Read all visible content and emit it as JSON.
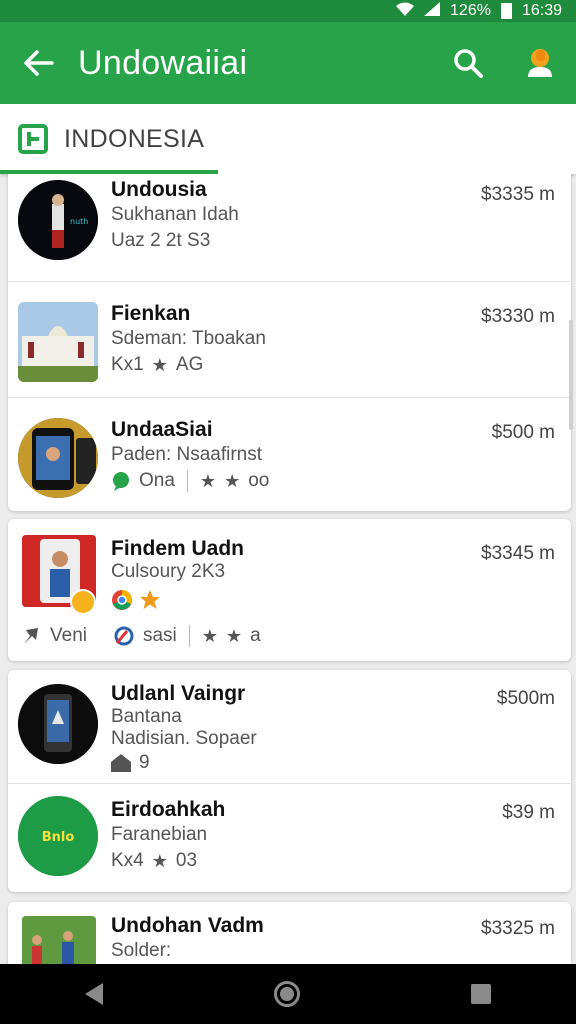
{
  "status_bar": {
    "battery": "126%",
    "time": "16:39"
  },
  "app_bar": {
    "title": "Undowaiiai",
    "back_icon": "arrow-back-icon",
    "search_icon": "search-icon",
    "account_icon": "person-icon"
  },
  "tab": {
    "label": "INDONESIA",
    "icon": "calendar-icon"
  },
  "items": [
    {
      "name": "Undousia",
      "sub": "Sukhanan Idah",
      "meta": "Uaz 2 2t   S3",
      "price": "$3335 m"
    },
    {
      "name": "Fienkan",
      "sub": "Sdeman: Tboakan",
      "meta_a": "Kx1",
      "meta_b": "AG",
      "price": "$3330 m"
    },
    {
      "name": "UndaaSiai",
      "sub": "Paden: Nsaafirnst",
      "meta_a": "Ona",
      "meta_b": "oo",
      "price": "$500 m"
    },
    {
      "name": "Findem Uadn",
      "sub": "Culsoury 2K3",
      "meta_a": "Veni",
      "meta_b": "sasi",
      "meta_c": "a",
      "price": "$3345 m"
    },
    {
      "name": "Udlanl Vaingr",
      "sub": "Bantana",
      "sub2": "Nadisian. Sopaer",
      "meta": "9",
      "price": "$500m"
    },
    {
      "name": "Eirdoahkah",
      "sub": "Faranebian",
      "meta_a": "Kx4",
      "meta_b": "03",
      "price": "$39 m"
    },
    {
      "name": "Undohan Vadm",
      "sub": "Solder:",
      "price": "$3325 m"
    }
  ],
  "colors": {
    "primary": "#27a449",
    "status": "#1e8a3c"
  }
}
